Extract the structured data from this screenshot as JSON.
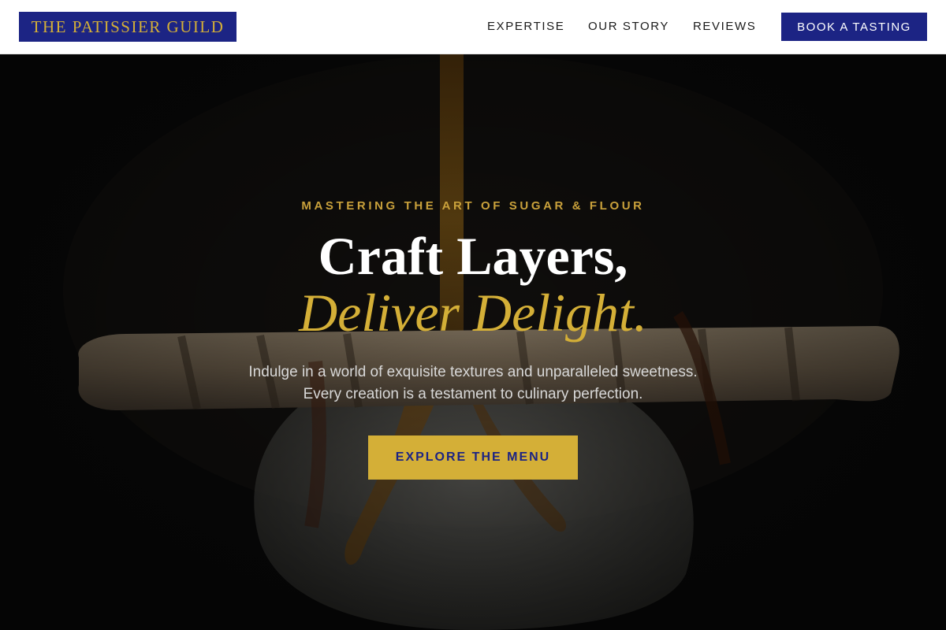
{
  "header": {
    "logo": "THE PATISSIER GUILD",
    "nav": [
      {
        "label": "EXPERTISE"
      },
      {
        "label": "OUR STORY"
      },
      {
        "label": "REVIEWS"
      }
    ],
    "cta_label": "BOOK A TASTING"
  },
  "hero": {
    "eyebrow": "MASTERING THE ART OF SUGAR & FLOUR",
    "headline_line1": "Craft Layers,",
    "headline_line2": "Deliver Delight.",
    "lede_line1": "Indulge in a world of exquisite textures and unparalleled sweetness.",
    "lede_line2": "Every creation is a testament to culinary perfection.",
    "cta_label": "EXPLORE THE MENU",
    "background_image": "dessert-photo"
  },
  "colors": {
    "navy": "#1c2484",
    "gold": "#d4af37",
    "hero_bg": "#0b0b0b"
  }
}
